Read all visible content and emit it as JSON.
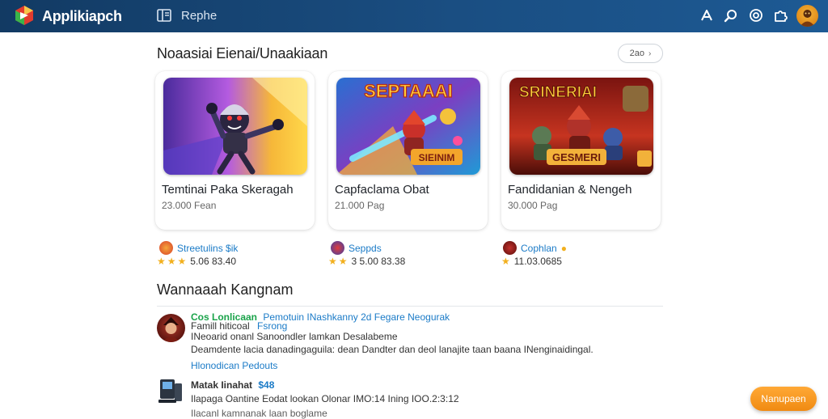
{
  "header": {
    "app_title": "Applikiapch",
    "nav_label": "Rephe",
    "icons": [
      "logo-icon",
      "menu-icon",
      "nav-icon",
      "search-icon",
      "target-icon",
      "puzzle-icon",
      "avatar"
    ]
  },
  "featured": {
    "title": "Noaasiai Eienai/Unaakiaan",
    "see_all": "2ao",
    "cards": [
      {
        "name": "Temtinai Paka Skeragah",
        "meta": "23.000 Fean",
        "developer": "Streetulins $ik",
        "rating_text": "5.06 83.40"
      },
      {
        "name": "Capfaclama Obat",
        "meta": "21.000 Pag",
        "developer": "Seppds",
        "rating_text": "3 5.00 83.38"
      },
      {
        "name": "Fandidanian & Nengeh",
        "meta": "30.000 Pag",
        "developer": "Cophlan",
        "rating_text": "11.03.0685"
      }
    ],
    "thumb_texts": [
      "SEPTAAAI",
      "SIEINIM",
      "SRINERIAI",
      "GESMERI"
    ]
  },
  "reviews": {
    "title": "Wannaaah Kangnam",
    "r1": {
      "name": "Cos Lonlicaan",
      "tag": "Pemotuin INashkanny 2d Fegare Neogurak",
      "sub1": "Famill hiticoal",
      "sub2": "Fsrong",
      "text1": "INeoarid onanl Sanoondler lamkan  Desalabeme",
      "text2": "Deamdente lacia danadingaguila: dean Dandter dan deol lanajite taan baana INenginaidingal.",
      "link": "Hlonodican Pedouts"
    },
    "r2": {
      "name": "Matak Iinahat",
      "price": "$48",
      "text1": "Ilapaga Oantine Eodat lookan Olonar IMO:14 Ining IOO.2:3:12",
      "text2": "Ilacanl kamnanak laan boglame"
    }
  },
  "fab": {
    "label": "Nanupaen"
  },
  "colors": {
    "topbar": "#1a4e82",
    "accent": "#f08a12",
    "link": "#1b7bc7",
    "green": "#1aa34a",
    "star": "#f2b01e"
  }
}
